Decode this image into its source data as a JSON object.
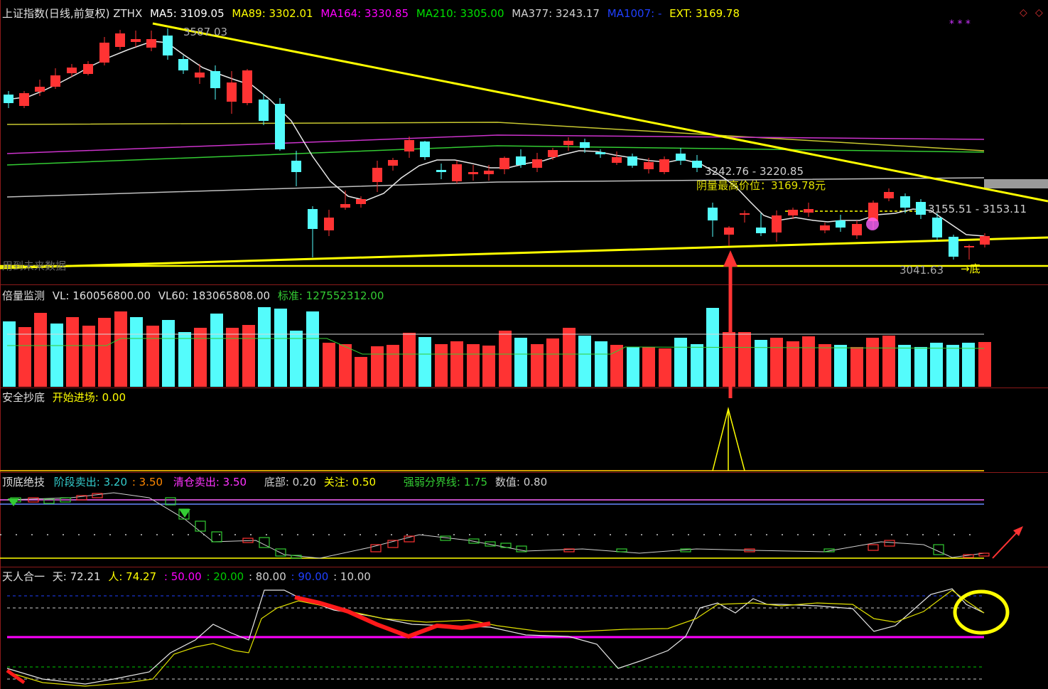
{
  "header": {
    "title": "上证指数(日线,前复权) ZTHX",
    "ma": [
      {
        "label": "MA5: 3109.05",
        "color": "#ffffff"
      },
      {
        "label": "MA89: 3302.01",
        "color": "#ffff00"
      },
      {
        "label": "MA164: 3330.85",
        "color": "#ff00ff"
      },
      {
        "label": "MA210: 3305.00",
        "color": "#00e000"
      },
      {
        "label": "MA377: 3243.17",
        "color": "#d0d0d0"
      },
      {
        "label": "MA1007: -",
        "color": "#2040ff"
      },
      {
        "label": "EXT: 3169.78",
        "color": "#ffff00"
      }
    ]
  },
  "price_chart": {
    "high_label": "3587.03",
    "range_label": "3242.76 - 3220.85",
    "yin_label": "阴量最高价位：3169.78元",
    "range2_label": "3155.51 - 3153.11",
    "low_label": "3041.63",
    "bottom_label": "→底",
    "future_label": "用到未来数据"
  },
  "volume_panel": {
    "title": "倍量监测",
    "vl": "VL: 160056800.00",
    "vl60": "VL60: 183065808.00",
    "std": "标准: 127552312.00"
  },
  "safe_panel": {
    "title": "安全抄底",
    "entry": "开始进场: 0.00"
  },
  "top_bottom_panel": {
    "title": "顶底绝技",
    "stage_sell_label": "阶段卖出: 3.20",
    "stage_sell_value": ": 3.50",
    "clear_sell": "清仓卖出: 3.50",
    "bottom": "底部: 0.20",
    "watch": "关注: 0.50",
    "divide": "强弱分界线: 1.75",
    "value": "数值: 0.80"
  },
  "tianren_panel": {
    "title": "天人合一",
    "tian": "天: 72.21",
    "ren": "人: 74.27",
    "v50": ": 50.00",
    "v20": ": 20.00",
    "v80": ": 80.00",
    "v90": ": 90.00",
    "v10": ": 10.00"
  },
  "colors": {
    "up": "#ff3333",
    "down": "#54fcfc",
    "trend": "#ffff00",
    "panel_border": "#8b1a1a"
  }
}
